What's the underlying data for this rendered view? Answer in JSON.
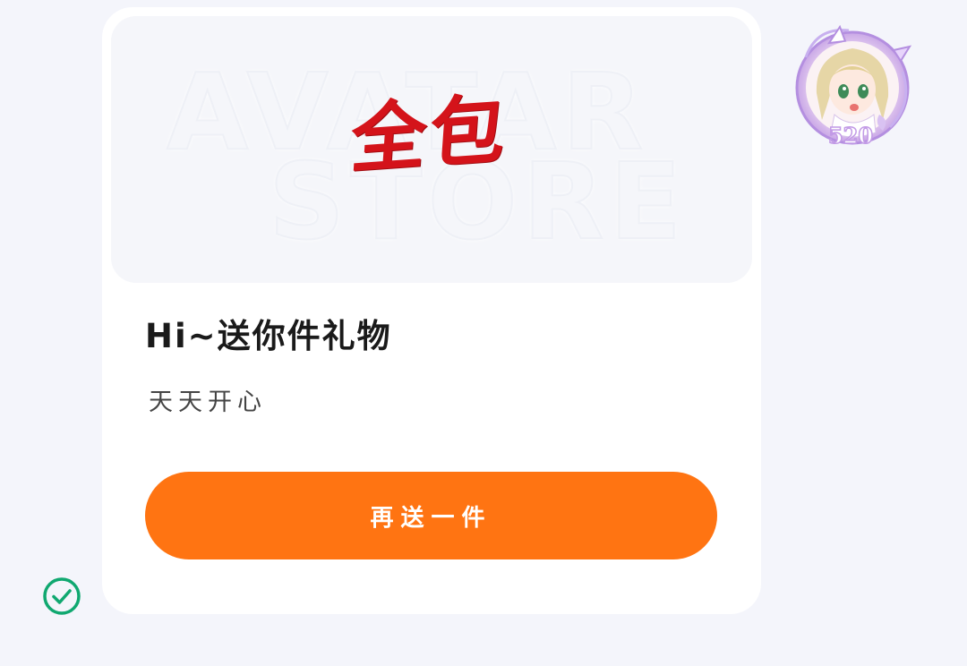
{
  "banner": {
    "watermark_line1": "AVATAR",
    "watermark_line2": "STORE",
    "brand_text": "全包"
  },
  "message": {
    "title": "Hi~送你件礼物",
    "subtitle": "天天开心"
  },
  "action": {
    "send_again_label": "再送一件"
  },
  "avatar": {
    "badge_number": "520"
  },
  "status": {
    "icon": "check-circle-icon",
    "color": "#10a870"
  },
  "colors": {
    "accent": "#ff7412",
    "brand_red": "#d4131a",
    "background": "#f4f5fb"
  }
}
